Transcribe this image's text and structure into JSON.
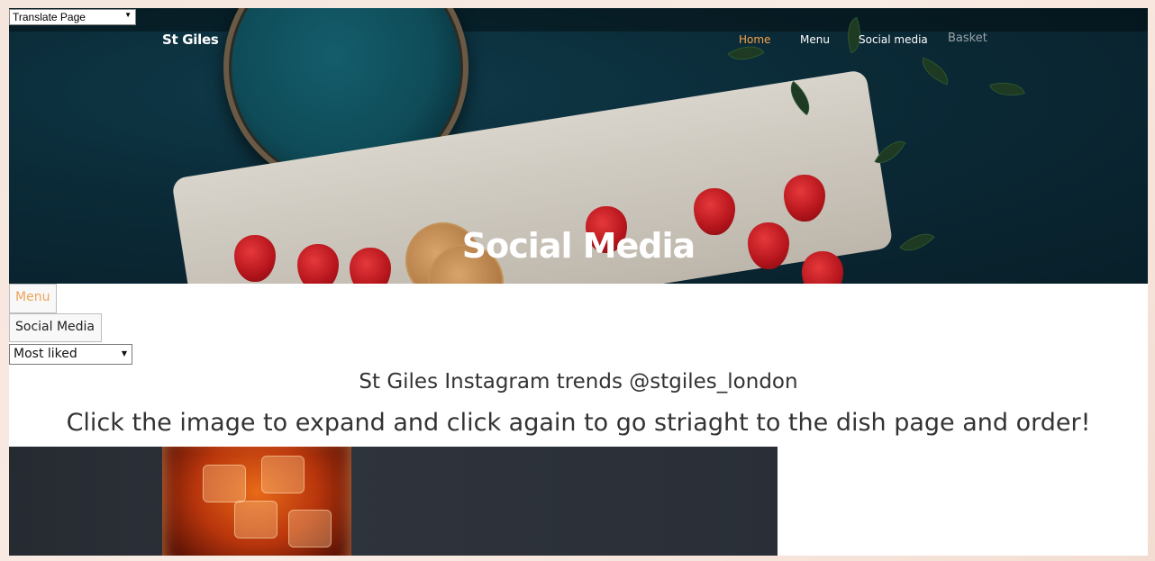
{
  "translate": {
    "label": "Translate Page"
  },
  "header": {
    "brand": "St Giles",
    "nav": [
      {
        "label": "Home",
        "active": true
      },
      {
        "label": "Menu",
        "active": false
      },
      {
        "label": "Social media",
        "active": false
      },
      {
        "label": "Basket",
        "active": false
      }
    ],
    "hero_title": "Social Media"
  },
  "controls": {
    "menu_button": "Menu",
    "social_button": "Social Media",
    "sort_selected": "Most liked"
  },
  "content": {
    "heading": "St Giles Instagram trends @stgiles_london",
    "subheading": "Click the image to expand and click again to go striaght to the dish page and order!"
  },
  "colors": {
    "accent": "#f7a24a",
    "hero_bg": "#0b2b38"
  }
}
